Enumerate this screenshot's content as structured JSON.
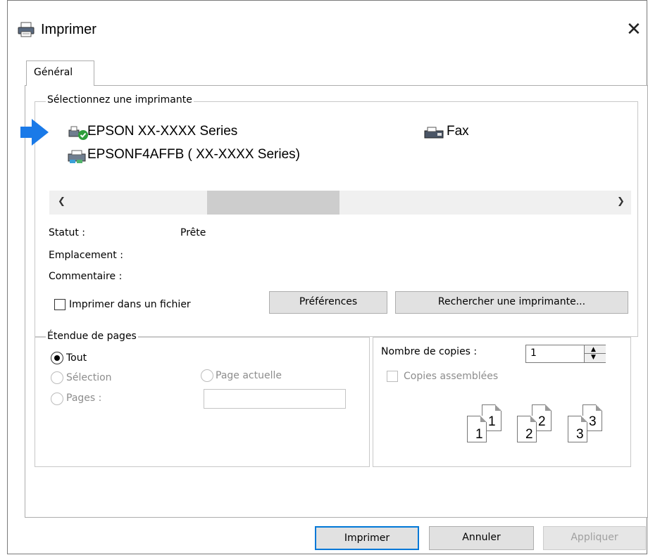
{
  "window": {
    "title": "Imprimer",
    "close_label": "✕"
  },
  "tabs": [
    {
      "label": "Général"
    }
  ],
  "printer_group": {
    "legend": "Sélectionnez une imprimante",
    "printers": [
      {
        "name": "EPSON XX-XXXX Series",
        "icon": "printer-default-icon",
        "selected": true
      },
      {
        "name": "EPSONF4AFFB ( XX-XXXX Series)",
        "icon": "network-printer-icon"
      },
      {
        "name": "Fax",
        "icon": "fax-icon"
      }
    ],
    "scroll_left": "❮",
    "scroll_right": "❯",
    "status_label": "Statut :",
    "status_value": "Prête",
    "location_label": "Emplacement :",
    "comment_label": "Commentaire :",
    "print_to_file_label": "Imprimer dans un fichier",
    "preferences_button": "Préférences",
    "find_printer_button": "Rechercher une imprimante..."
  },
  "page_range_group": {
    "legend": "Étendue de pages",
    "all_label": "Tout",
    "selection_label": "Sélection",
    "current_page_label": "Page actuelle",
    "pages_label": "Pages :",
    "pages_value": ""
  },
  "copies_group": {
    "copies_label": "Nombre de copies :",
    "copies_value": "1",
    "collate_label": "Copies assemblées",
    "collate_icons": [
      "1",
      "1",
      "2",
      "2",
      "3",
      "3"
    ]
  },
  "footer": {
    "print_button": "Imprimer",
    "cancel_button": "Annuler",
    "apply_button": "Appliquer"
  },
  "colors": {
    "accent": "#0078d7",
    "arrow": "#1a7ae8",
    "button_bg": "#e1e1e1"
  }
}
